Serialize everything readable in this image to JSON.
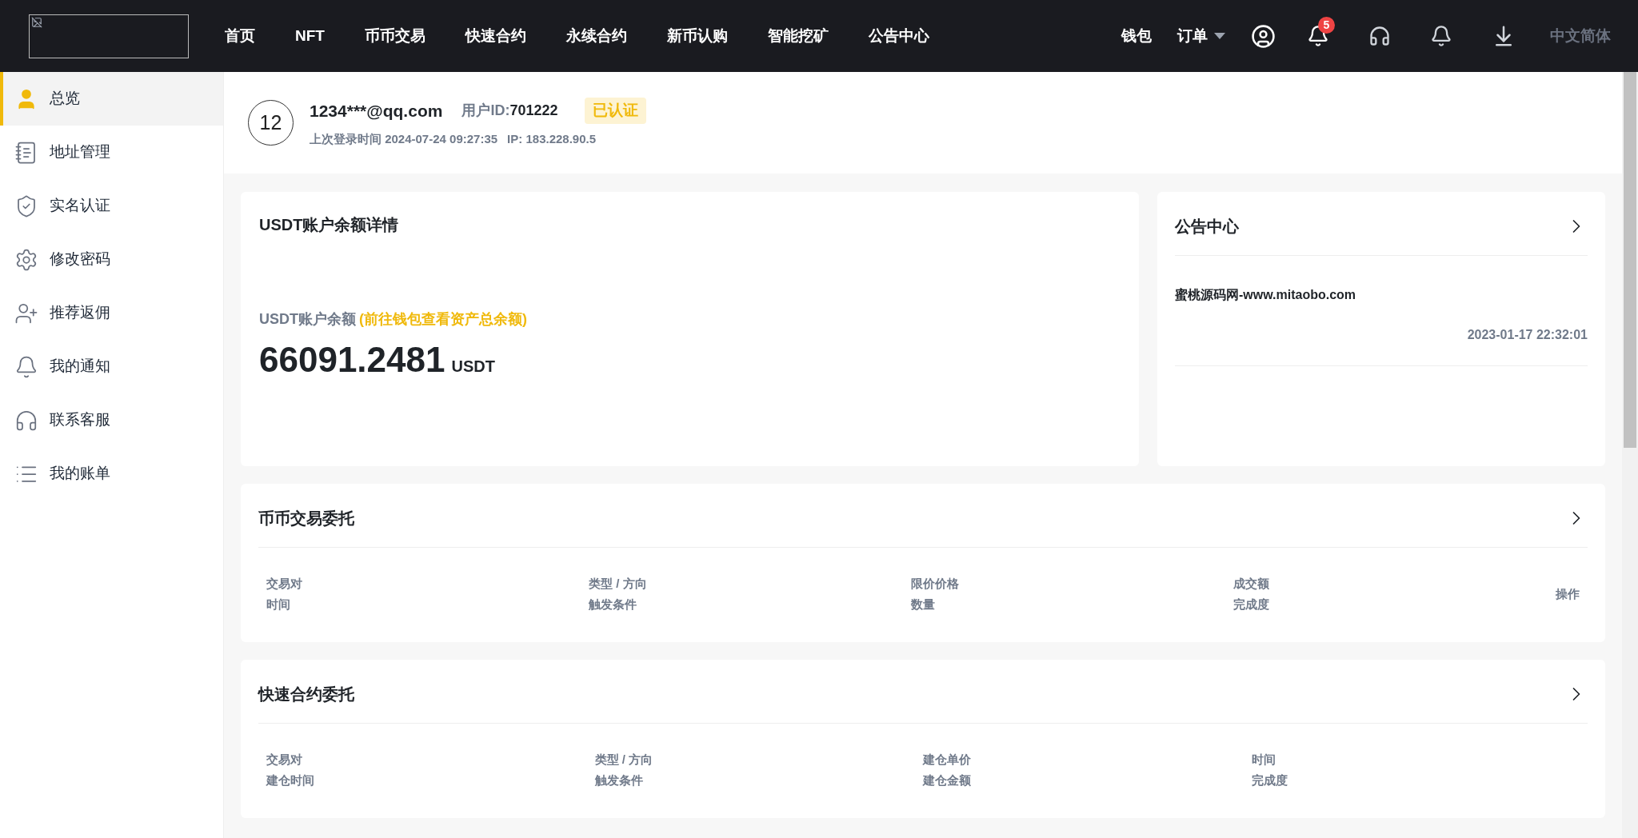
{
  "nav": {
    "items": [
      {
        "label": "首页"
      },
      {
        "label": "NFT"
      },
      {
        "label": "币币交易"
      },
      {
        "label": "快速合约"
      },
      {
        "label": "永续合约"
      },
      {
        "label": "新币认购"
      },
      {
        "label": "智能挖矿"
      },
      {
        "label": "公告中心"
      }
    ],
    "wallet": "钱包",
    "orders": "订单",
    "notification_count": "5",
    "language": "中文简体"
  },
  "sidebar": {
    "items": [
      {
        "label": "总览",
        "selected": true
      },
      {
        "label": "地址管理",
        "selected": false
      },
      {
        "label": "实名认证",
        "selected": false
      },
      {
        "label": "修改密码",
        "selected": false
      },
      {
        "label": "推荐返佣",
        "selected": false
      },
      {
        "label": "我的通知",
        "selected": false
      },
      {
        "label": "联系客服",
        "selected": false
      },
      {
        "label": "我的账单",
        "selected": false
      }
    ]
  },
  "profile": {
    "avatar": "12",
    "email": "1234***@qq.com",
    "user_id_label": "用户ID:",
    "user_id": "701222",
    "verified_badge": "已认证",
    "last_login": "上次登录时间 2024-07-24 09:27:35",
    "ip": "IP: 183.228.90.5"
  },
  "balance_card": {
    "title": "USDT账户余额详情",
    "label": "USDT账户余额",
    "link": "(前往钱包查看资产总余额)",
    "amount": "66091.2481",
    "unit": "USDT"
  },
  "notice_card": {
    "title": "公告中心",
    "items": [
      {
        "title": "蜜桃源码网-www.mitaobo.com",
        "time": "2023-01-17 22:32:01"
      }
    ]
  },
  "order_cards": [
    {
      "title": "币币交易委托",
      "columns": [
        [
          "交易对",
          "时间"
        ],
        [
          "类型 / 方向",
          "触发条件"
        ],
        [
          "限价价格",
          "数量"
        ],
        [
          "成交额",
          "完成度"
        ]
      ],
      "action": "操作"
    },
    {
      "title": "快速合约委托",
      "columns": [
        [
          "交易对",
          "建仓时间"
        ],
        [
          "类型 / 方向",
          "触发条件"
        ],
        [
          "建仓单价",
          "建仓金额"
        ],
        [
          "时间",
          "完成度"
        ]
      ]
    }
  ]
}
